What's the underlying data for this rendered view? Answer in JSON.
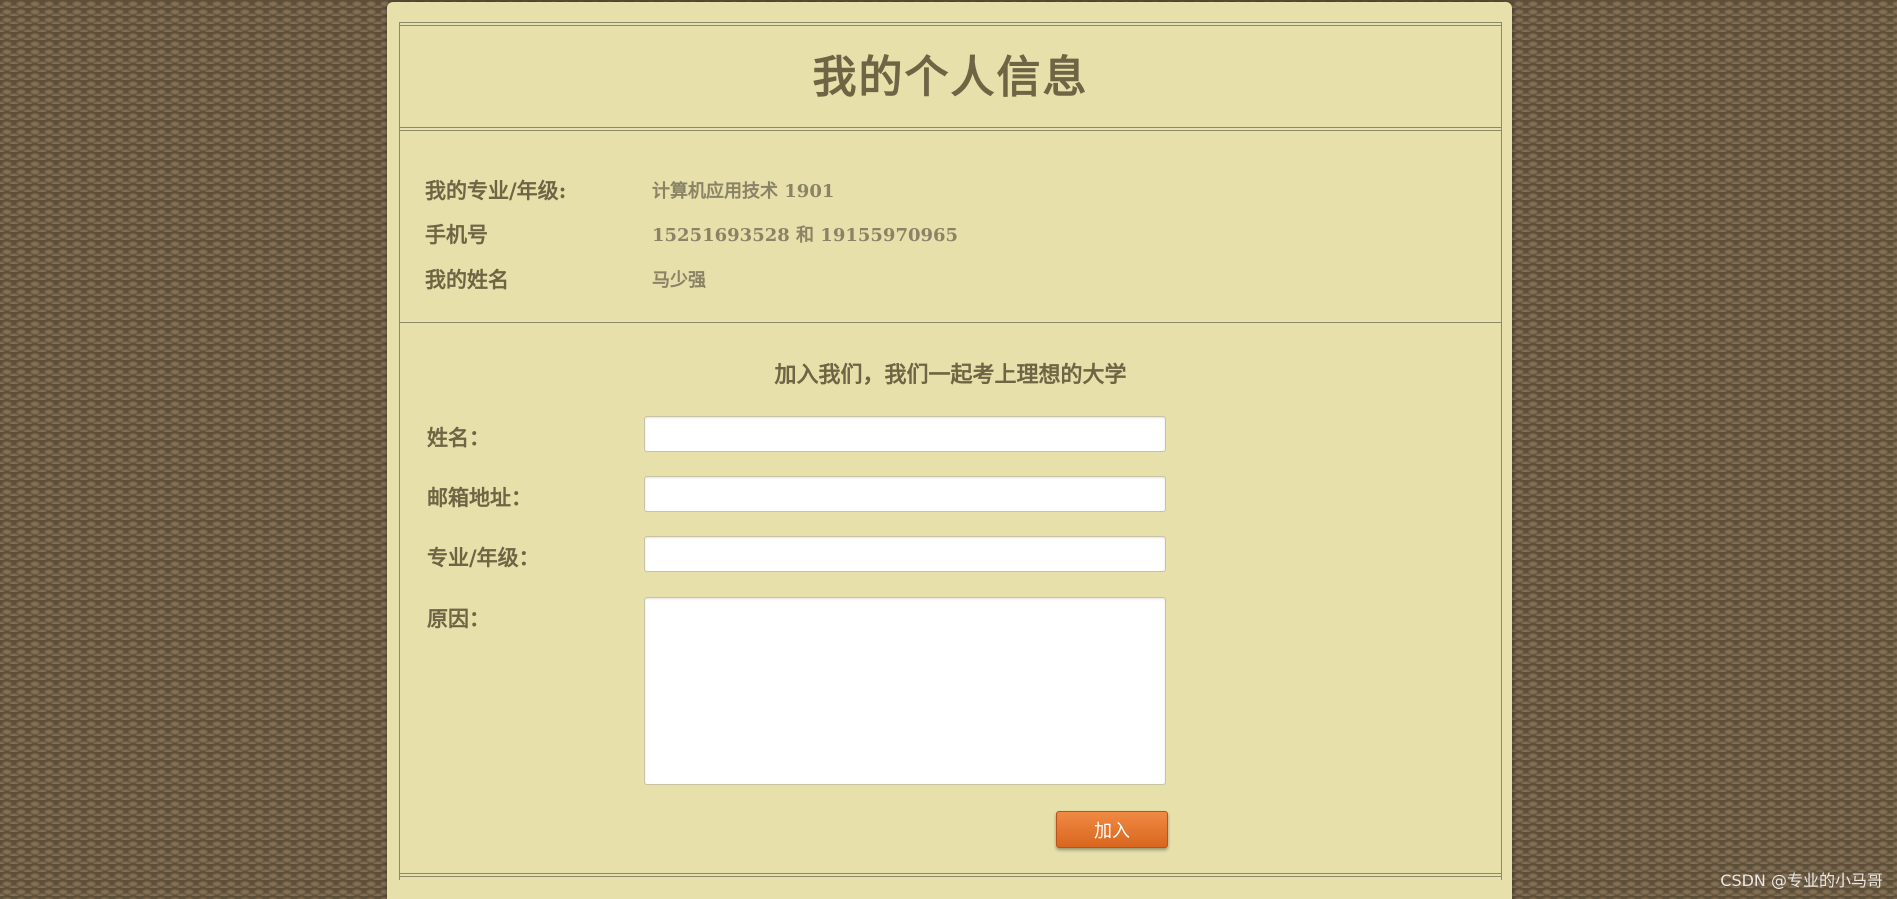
{
  "header": {
    "title": "我的个人信息"
  },
  "profile": {
    "rows": [
      {
        "label": "我的专业/年级:",
        "value": "计算机应用技术 1901"
      },
      {
        "label": "手机号",
        "value": "15251693528 和 19155970965"
      },
      {
        "label": "我的姓名",
        "value": "马少强"
      }
    ]
  },
  "join_form": {
    "heading": "加入我们，我们一起考上理想的大学",
    "fields": {
      "name": {
        "label": "姓名：",
        "value": "",
        "placeholder": ""
      },
      "email": {
        "label": "邮箱地址：",
        "value": "",
        "placeholder": ""
      },
      "major": {
        "label": "专业/年级：",
        "value": "",
        "placeholder": ""
      },
      "reason": {
        "label": "原因：",
        "value": "",
        "placeholder": ""
      }
    },
    "submit_label": "加入"
  },
  "watermark": "CSDN @专业的小马哥",
  "colors": {
    "panel_background": "#e8e0ab",
    "text_primary": "#6f6545",
    "text_secondary": "#8a8366",
    "button": "#e57a33",
    "page_background": "#6b5a44"
  }
}
